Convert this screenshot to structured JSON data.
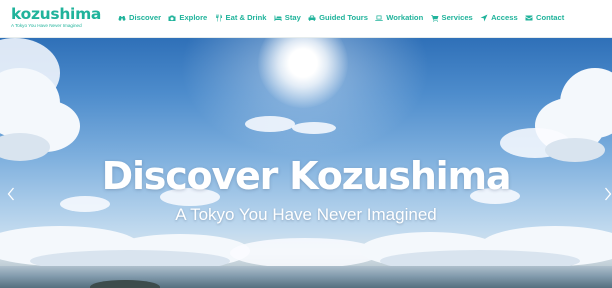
{
  "brand": {
    "name": "kozushima",
    "tagline": "A Tokyo You Have Never Imagined",
    "color": "#20b39b"
  },
  "nav": {
    "items": [
      {
        "label": "Discover",
        "icon": "binoculars-icon"
      },
      {
        "label": "Explore",
        "icon": "camera-icon"
      },
      {
        "label": "Eat & Drink",
        "icon": "utensils-icon"
      },
      {
        "label": "Stay",
        "icon": "bed-icon"
      },
      {
        "label": "Guided Tours",
        "icon": "car-icon"
      },
      {
        "label": "Workation",
        "icon": "laptop-icon"
      },
      {
        "label": "Services",
        "icon": "cart-icon"
      },
      {
        "label": "Access",
        "icon": "location-arrow-icon"
      },
      {
        "label": "Contact",
        "icon": "envelope-icon"
      }
    ]
  },
  "hero": {
    "title": "Discover Kozushima",
    "subtitle": "A Tokyo You Have Never Imagined",
    "prev_icon": "chevron-left-icon",
    "next_icon": "chevron-right-icon"
  }
}
